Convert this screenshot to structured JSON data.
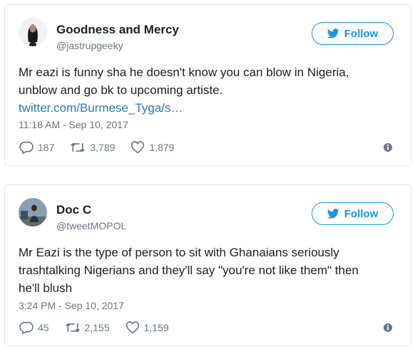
{
  "tweets": [
    {
      "display_name": "Goodness and Mercy",
      "handle": "@jastrupgeeky",
      "follow_label": "Follow",
      "text": "Mr eazi is funny sha he doesn't know you can blow in Nigeria, unblow and go bk to upcoming artiste.",
      "link": "twitter.com/Burmese_Tyga/s…",
      "timestamp": "11:18 AM - Sep 10, 2017",
      "replies": "187",
      "retweets": "3,789",
      "likes": "1,879"
    },
    {
      "display_name": "Doc C",
      "handle": "@tweetMOPOL",
      "follow_label": "Follow",
      "text": "Mr Eazi is the type of person to sit with Ghanaians seriously trashtalking Nigerians and they'll say \"you're not like them\" then he'll blush",
      "timestamp": "3:24 PM - Sep 10, 2017",
      "replies": "45",
      "retweets": "2,155",
      "likes": "1,159"
    }
  ],
  "colors": {
    "accent": "#1b95e0",
    "link": "#2b7bb9",
    "muted": "#697882",
    "border": "#e1e8ed"
  },
  "icons": [
    "twitter-bird-icon",
    "reply-icon",
    "retweet-icon",
    "like-heart-icon",
    "info-icon"
  ]
}
